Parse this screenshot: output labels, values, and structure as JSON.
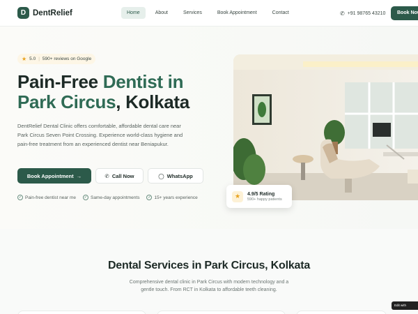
{
  "nav": {
    "logo_letter": "D",
    "brand": "DentRelief",
    "links": [
      "Home",
      "About",
      "Services",
      "Book Appointment",
      "Contact"
    ],
    "phone": "+91 98765 43210",
    "cta": "Book Now"
  },
  "hero": {
    "rating_value": "5.0",
    "reviews": "590+ reviews on Google",
    "title_line1_a": "Pain-Free ",
    "title_line1_b": "Dentist in",
    "title_line2_a": "Park Circus",
    "title_line2_b": ", Kolkata",
    "description": "DentRelief Dental Clinic offers comfortable, affordable dental care near Park Circus Seven Point Crossing. Experience world-class hygiene and pain-free treatment from an experienced dentist near Beniapukur.",
    "btn_book": "Book Appointment",
    "btn_call": "Call Now",
    "btn_whatsapp": "WhatsApp",
    "features": [
      "Pain-free dentist near me",
      "Same-day appointments",
      "15+ years experience"
    ],
    "card_rating": "4.9/5 Rating",
    "card_sub": "590+ happy patients"
  },
  "services": {
    "title": "Dental Services in Park Circus, Kolkata",
    "description": "Comprehensive dental clinic in Park Circus with modern technology and a gentle touch. From RCT in Kolkata to affordable teeth cleaning."
  },
  "edit_badge": "Edit with",
  "colors": {
    "brand": "#2c5a4a",
    "accent_text": "#2f6b55",
    "star": "#e8a21d"
  },
  "icons": [
    "phone-icon",
    "star-icon",
    "arrow-right-icon",
    "call-icon",
    "whatsapp-icon",
    "check-circle-icon"
  ]
}
